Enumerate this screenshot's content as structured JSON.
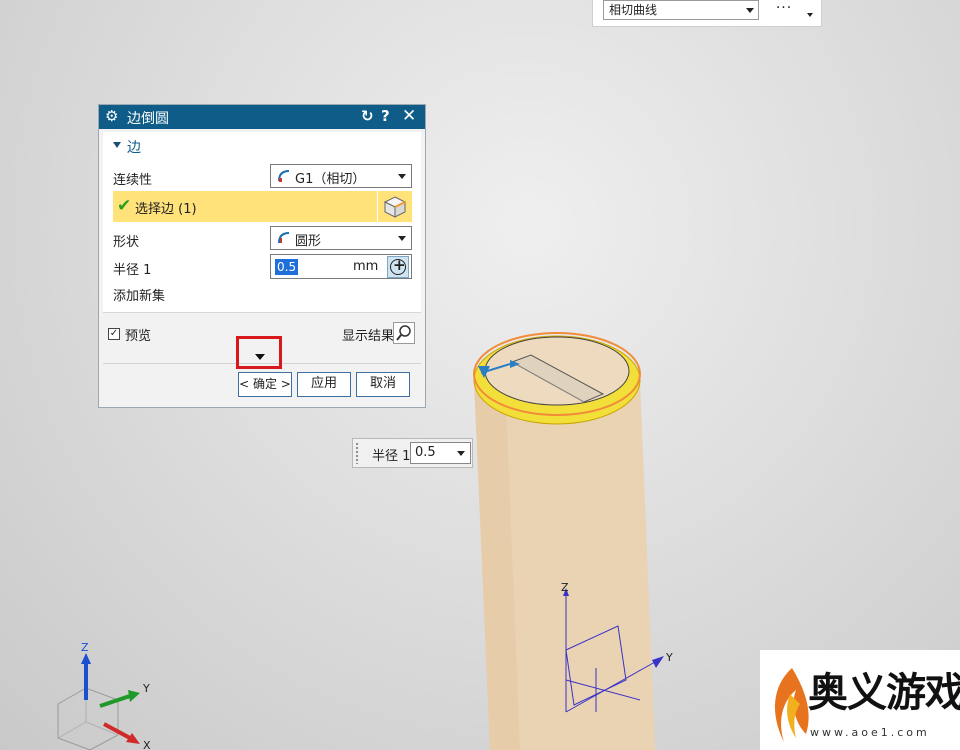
{
  "toolbar": {
    "curve_rule_value": "相切曲线",
    "more_label": "···"
  },
  "dialog": {
    "title": "边倒圆",
    "section_title": "边",
    "continuity_label": "连续性",
    "continuity_value": "G1（相切）",
    "select_edge_label": "选择边 (1)",
    "shape_label": "形状",
    "shape_value": "圆形",
    "radius_label": "半径 1",
    "radius_value": "0.5",
    "radius_unit": "mm",
    "add_set_label": "添加新集",
    "preview_label": "预览",
    "preview_checked": true,
    "show_result_label": "显示结果",
    "ok_label": "< 确定 >",
    "apply_label": "应用",
    "cancel_label": "取消"
  },
  "radius_popup": {
    "label": "半径 1",
    "value": "0.5"
  },
  "triad_bottom_left": {
    "z": "Z",
    "y": "Y",
    "x": "X"
  },
  "triad_model": {
    "z": "Z",
    "y": "Y"
  },
  "watermark": {
    "name": "奥义游戏网",
    "url": "www.aoe1.com"
  },
  "colors": {
    "title_bar": "#0e5c87",
    "selection_row": "#ffe27a",
    "highlight_box": "#d7191c",
    "model_body": "#ead3b2",
    "edge_highlight": "#f2df3a"
  }
}
